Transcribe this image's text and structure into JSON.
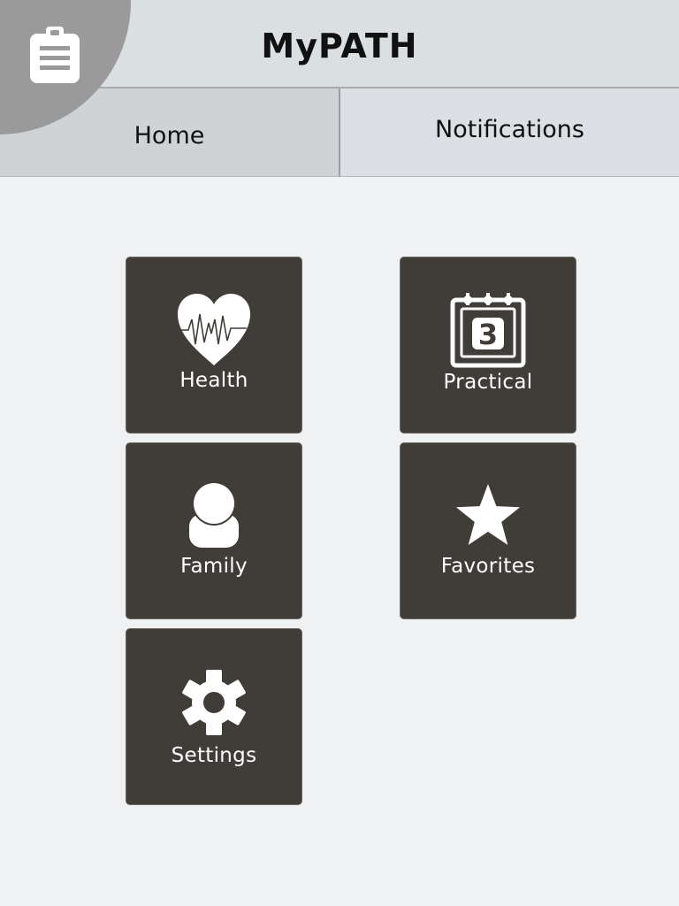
{
  "header": {
    "title": "MyPATH"
  },
  "tabs": [
    {
      "label": "Home",
      "selected": true
    },
    {
      "label": "Notifications",
      "selected": false
    }
  ],
  "corner_menu": {
    "icon": "clipboard-icon"
  },
  "tiles": [
    {
      "label": "Health",
      "icon": "heart-pulse-icon"
    },
    {
      "label": "Practical",
      "icon": "calendar-icon",
      "calendar_day": "3"
    },
    {
      "label": "Family",
      "icon": "person-icon"
    },
    {
      "label": "Favorites",
      "icon": "star-icon"
    },
    {
      "label": "Settings",
      "icon": "gear-icon"
    }
  ],
  "colors": {
    "header_bg": "#dadfe2",
    "tab_home_bg": "#cfd3d6",
    "tab_notifications_bg": "#dcdfe3",
    "page_bg": "#f0f1f3",
    "tile_bg": "#403d38",
    "corner_bg": "#9a9a9a"
  }
}
